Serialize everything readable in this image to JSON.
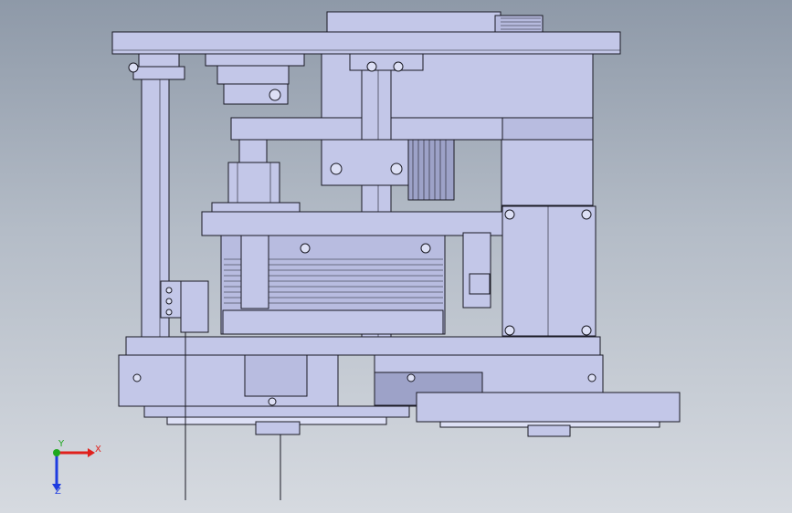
{
  "viewport": {
    "background_top": "#8e99a8",
    "background_bottom": "#d6dae0"
  },
  "model": {
    "part_fill": "#c3c7e8",
    "part_fill_dark": "#9da2c8",
    "part_fill_light": "#dde0f5",
    "edge_color": "#1a1a24",
    "icon": "cad-assembly-model"
  },
  "triad": {
    "x_label": "X",
    "y_label": "Y",
    "z_label": "Z",
    "x_color": "#e0201c",
    "y_color": "#1ea81e",
    "z_color": "#1e3ce0",
    "icon": "coordinate-triad-icon"
  }
}
